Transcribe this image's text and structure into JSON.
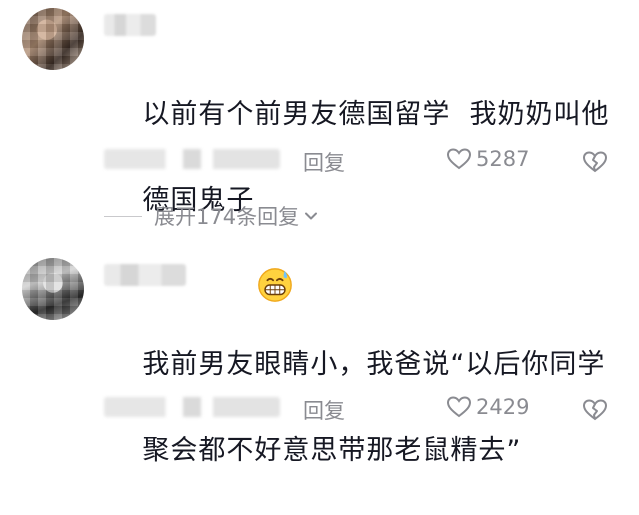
{
  "comments": [
    {
      "text_line1": "以前有个前男友德国留学  我奶奶叫他",
      "text_line2": "德国鬼子",
      "emoji": "grinning-sweat-emoji",
      "reply_label": "回复",
      "likes": "5287",
      "expand_label": "展开174条回复"
    },
    {
      "text_line1": "我前男友眼睛小，我爸说“以后你同学",
      "text_line2": "聚会都不好意思带那老鼠精去”",
      "reply_label": "回复",
      "likes": "2429"
    }
  ],
  "colors": {
    "text": "#161823",
    "secondary": "#8a8b91",
    "background": "#ffffff"
  },
  "icons": [
    "heart-outline-icon",
    "broken-heart-icon",
    "chevron-down-icon"
  ]
}
